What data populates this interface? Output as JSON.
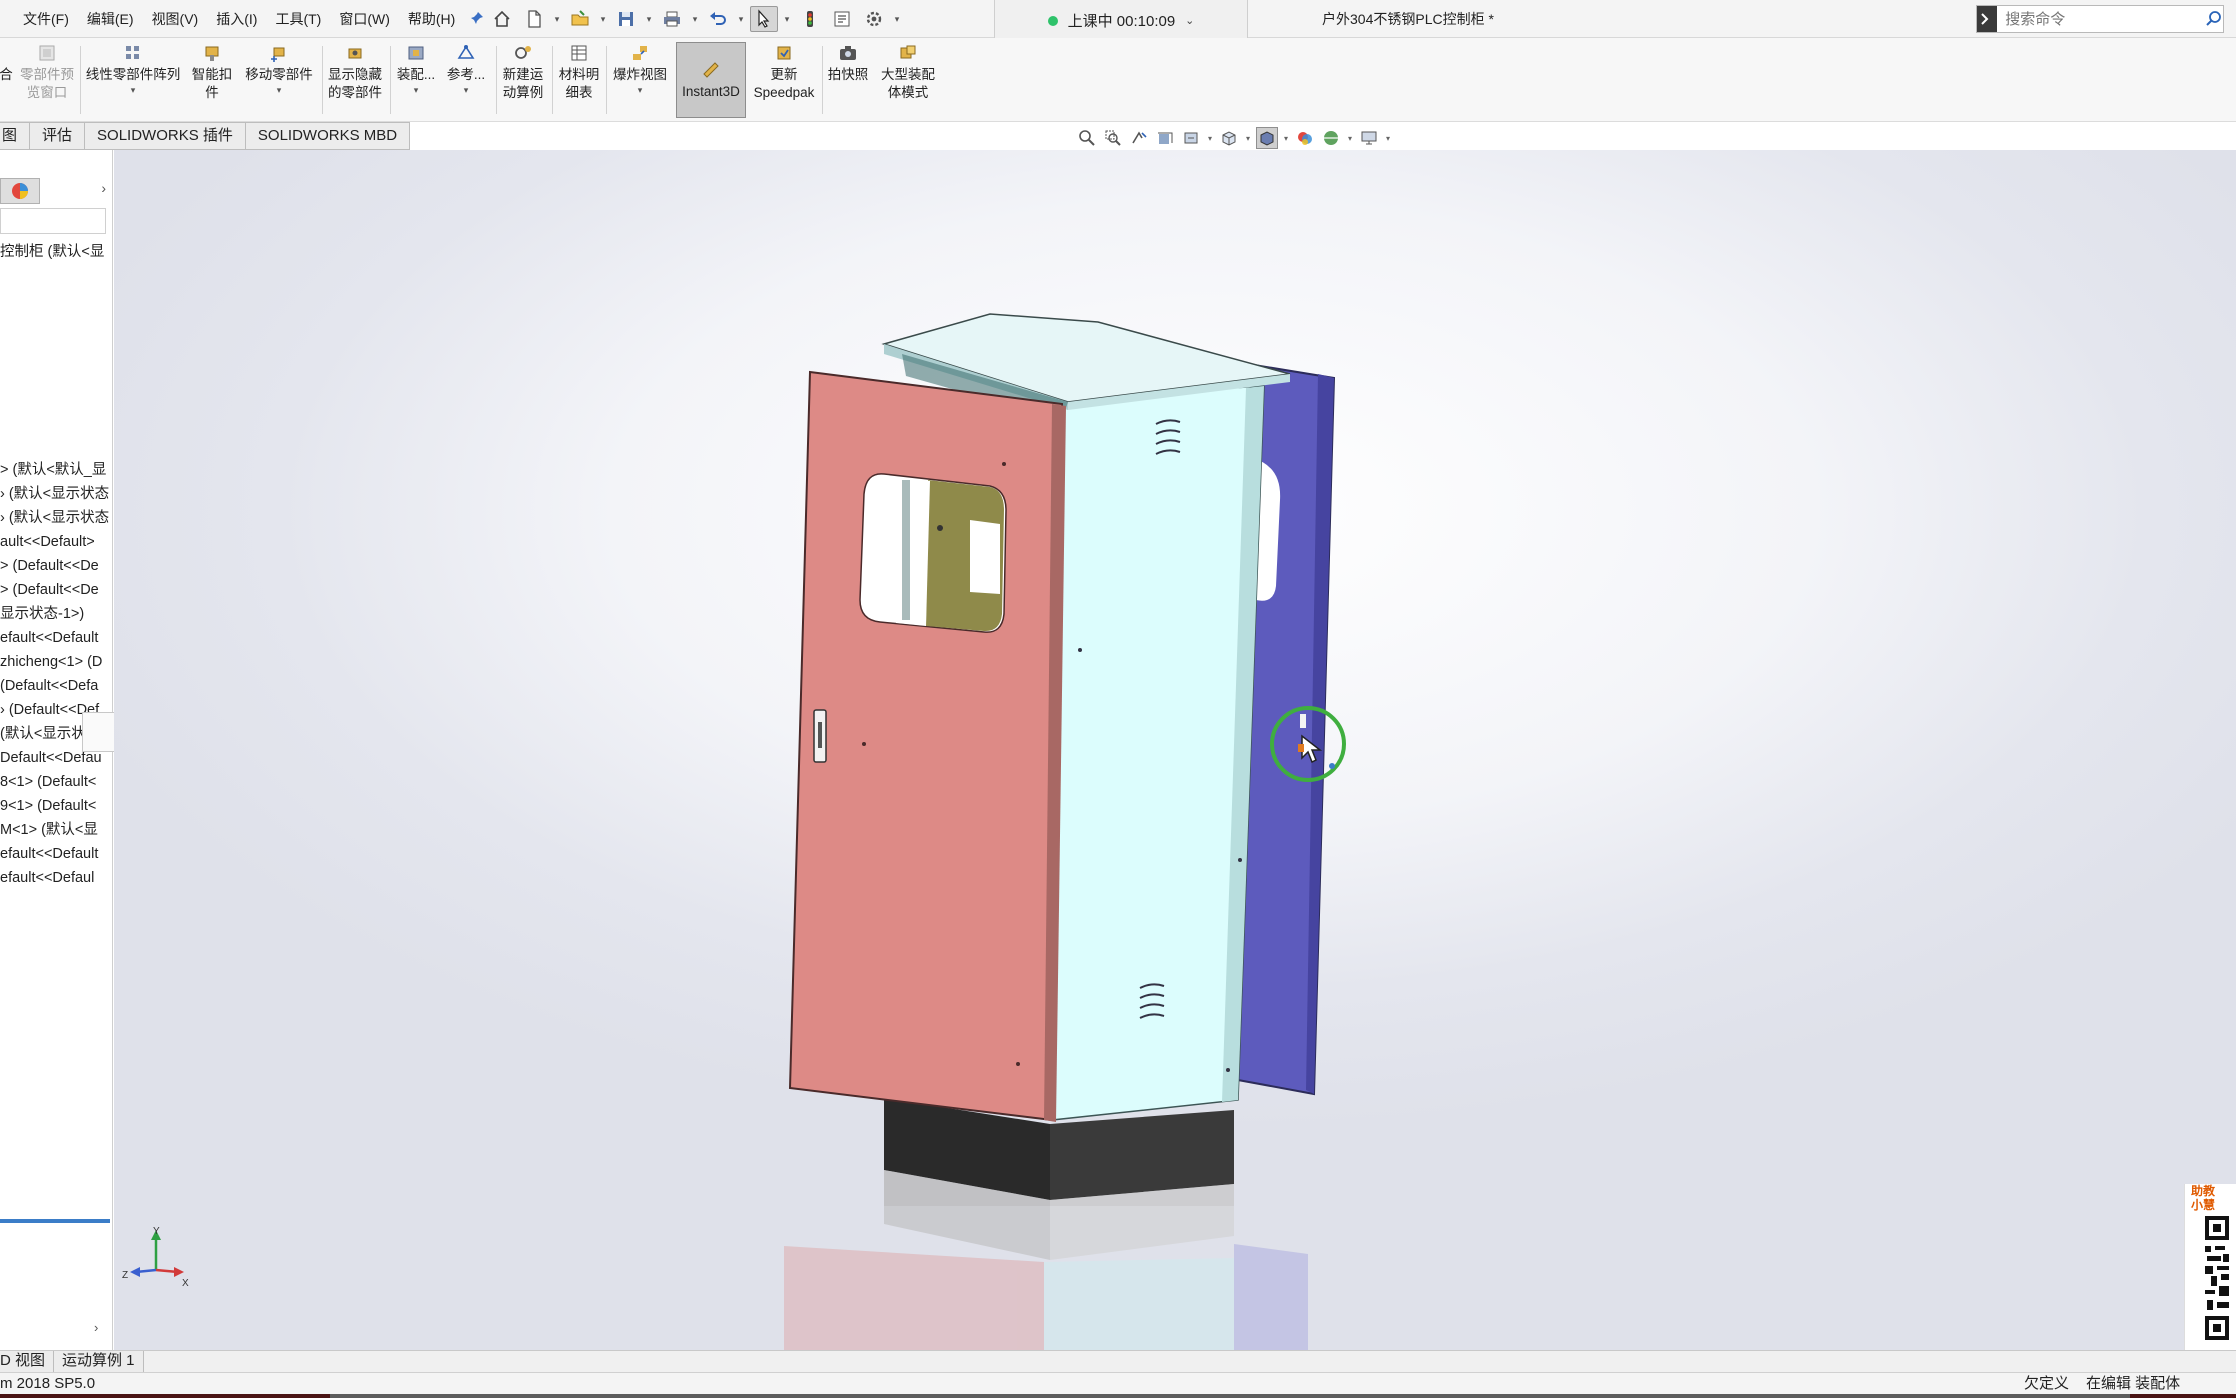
{
  "menu": {
    "items": [
      "文件(F)",
      "编辑(E)",
      "视图(V)",
      "插入(I)",
      "工具(T)",
      "窗口(W)",
      "帮助(H)"
    ]
  },
  "session": {
    "label": "上课中 00:10:09"
  },
  "document": {
    "title": "户外304不锈钢PLC控制柜 *"
  },
  "search": {
    "placeholder": "搜索命令"
  },
  "commands": {
    "partial_left": "合",
    "preview_window": "零部件预览窗口",
    "preview_window_l1": "零部件预",
    "preview_window_l2": "览窗口",
    "linear_pattern": "线性零部件阵列",
    "smart_fasteners_l1": "智能扣",
    "smart_fasteners_l2": "件",
    "move_component": "移动零部件",
    "show_hidden_l1": "显示隐藏",
    "show_hidden_l2": "的零部件",
    "assembly_features": "装配...",
    "reference_geometry": "参考...",
    "new_motion_l1": "新建运",
    "new_motion_l2": "动算例",
    "bom_l1": "材料明",
    "bom_l2": "细表",
    "exploded_view": "爆炸视图",
    "instant3d": "Instant3D",
    "speedpak_l1": "更新",
    "speedpak_l2": "Speedpak",
    "snapshot": "拍快照",
    "large_assembly_l1": "大型装配",
    "large_assembly_l2": "体模式"
  },
  "tabs": [
    "图",
    "评估",
    "SOLIDWORKS 插件",
    "SOLIDWORKS MBD"
  ],
  "tree": {
    "root": "控制柜 (默认<显",
    "items": [
      "> (默认<默认_显",
      "› (默认<显示状态",
      "› (默认<显示状态",
      "ault<<Default>",
      "> (Default<<De",
      "> (Default<<De",
      "显示状态-1>)",
      "efault<<Default",
      "zhicheng<1> (D",
      "(Default<<Defa",
      "› (Default<<Def",
      "(默认<显示状态",
      "Default<<Defau",
      "8<1> (Default<",
      "9<1> (Default<",
      "M<1> (默认<显",
      "efault<<Default",
      "efault<<Defaul"
    ]
  },
  "triad": {
    "y": "Y",
    "x": "X",
    "z": "Z"
  },
  "qr": {
    "line1": "助教",
    "line2": "小慧"
  },
  "bottom_tabs": [
    "D 视图",
    "运动算例 1"
  ],
  "status": {
    "version": "m 2018 SP5.0",
    "definition": "欠定义",
    "mode": "在编辑 装配体"
  },
  "colors": {
    "door_left": "#dd8a86",
    "cabinet_body": "#dcfdfd",
    "door_right": "#5d5bbd",
    "roof": "#e6f6f7",
    "base": "#2e2e2e",
    "accent_blue": "#3b7dc8",
    "cursor_ring": "#3fae3f"
  }
}
